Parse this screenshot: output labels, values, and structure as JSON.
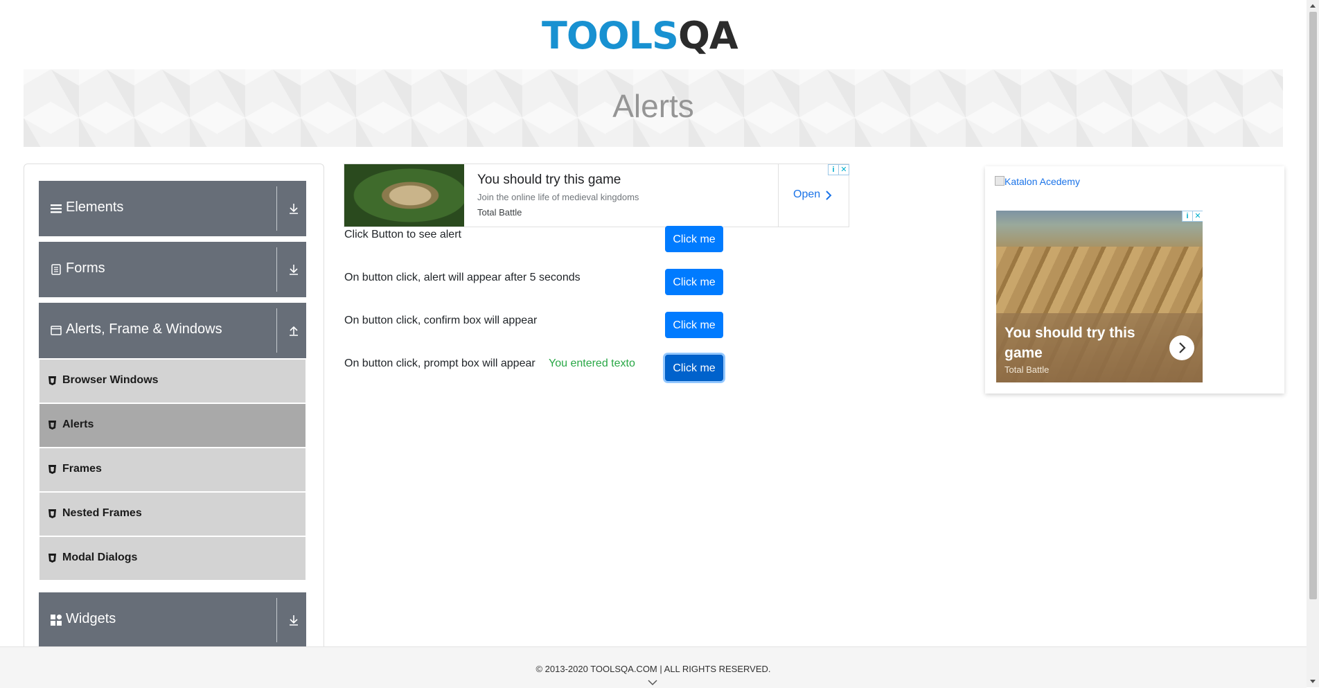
{
  "header": {
    "logo_tools": "TOOLS",
    "logo_qa": "QA",
    "page_title": "Alerts"
  },
  "sidebar": {
    "groups": [
      {
        "label": "Elements",
        "expanded": false
      },
      {
        "label": "Forms",
        "expanded": false
      },
      {
        "label": "Alerts, Frame & Windows",
        "expanded": true
      },
      {
        "label": "Widgets",
        "expanded": false
      }
    ],
    "items": [
      {
        "label": "Browser Windows",
        "active": false
      },
      {
        "label": "Alerts",
        "active": true
      },
      {
        "label": "Frames",
        "active": false
      },
      {
        "label": "Nested Frames",
        "active": false
      },
      {
        "label": "Modal Dialogs",
        "active": false
      }
    ]
  },
  "ad_top": {
    "title": "You should try this game",
    "description": "Join the online life of medieval kingdoms",
    "brand": "Total Battle",
    "cta": "Open",
    "adchoice_info": "i",
    "adchoice_close": "✕"
  },
  "alerts": {
    "rows": [
      {
        "text": "Click Button to see alert",
        "button": "Click me"
      },
      {
        "text": "On button click, alert will appear after 5 seconds",
        "button": "Click me"
      },
      {
        "text": "On button click, confirm box will appear",
        "button": "Click me"
      },
      {
        "text": "On button click, prompt box will appear",
        "button": "Click me",
        "result": "You entered texto"
      }
    ]
  },
  "ad_right": {
    "broken_image_alt": "Katalon Acedemy",
    "title": "You should try this game",
    "brand": "Total Battle",
    "adchoice_info": "i",
    "adchoice_close": "✕"
  },
  "footer": {
    "text": "© 2013-2020 TOOLSQA.COM | ALL RIGHTS RESERVED."
  },
  "colors": {
    "accent": "#007bff",
    "nav_header": "#676e78",
    "nav_item": "#d3d3d3",
    "nav_item_active": "#a9a9a9",
    "success": "#28a745"
  },
  "icons": {
    "elements": "hamburger-icon",
    "forms": "document-icon",
    "alerts_frames": "window-icon",
    "widgets": "grid-icon",
    "item": "html5-shield-icon"
  }
}
